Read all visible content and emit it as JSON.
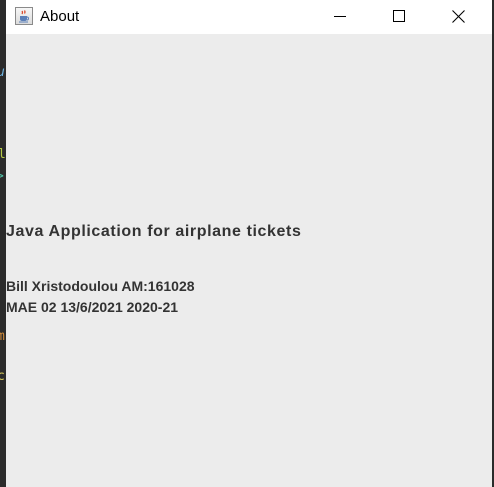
{
  "window": {
    "title": "About",
    "icon": "java-cup-icon",
    "controls": [
      "minimize-icon",
      "maximize-icon",
      "close-icon"
    ]
  },
  "content": {
    "heading": "Java Application for airplane tickets",
    "author_line": "Bill Xristodoulou AM:161028",
    "course_line": "MAE 02 13/6/2021 2020-21"
  },
  "colors": {
    "titlebar": "#ffffff",
    "body": "#ececec",
    "text": "#333333"
  }
}
